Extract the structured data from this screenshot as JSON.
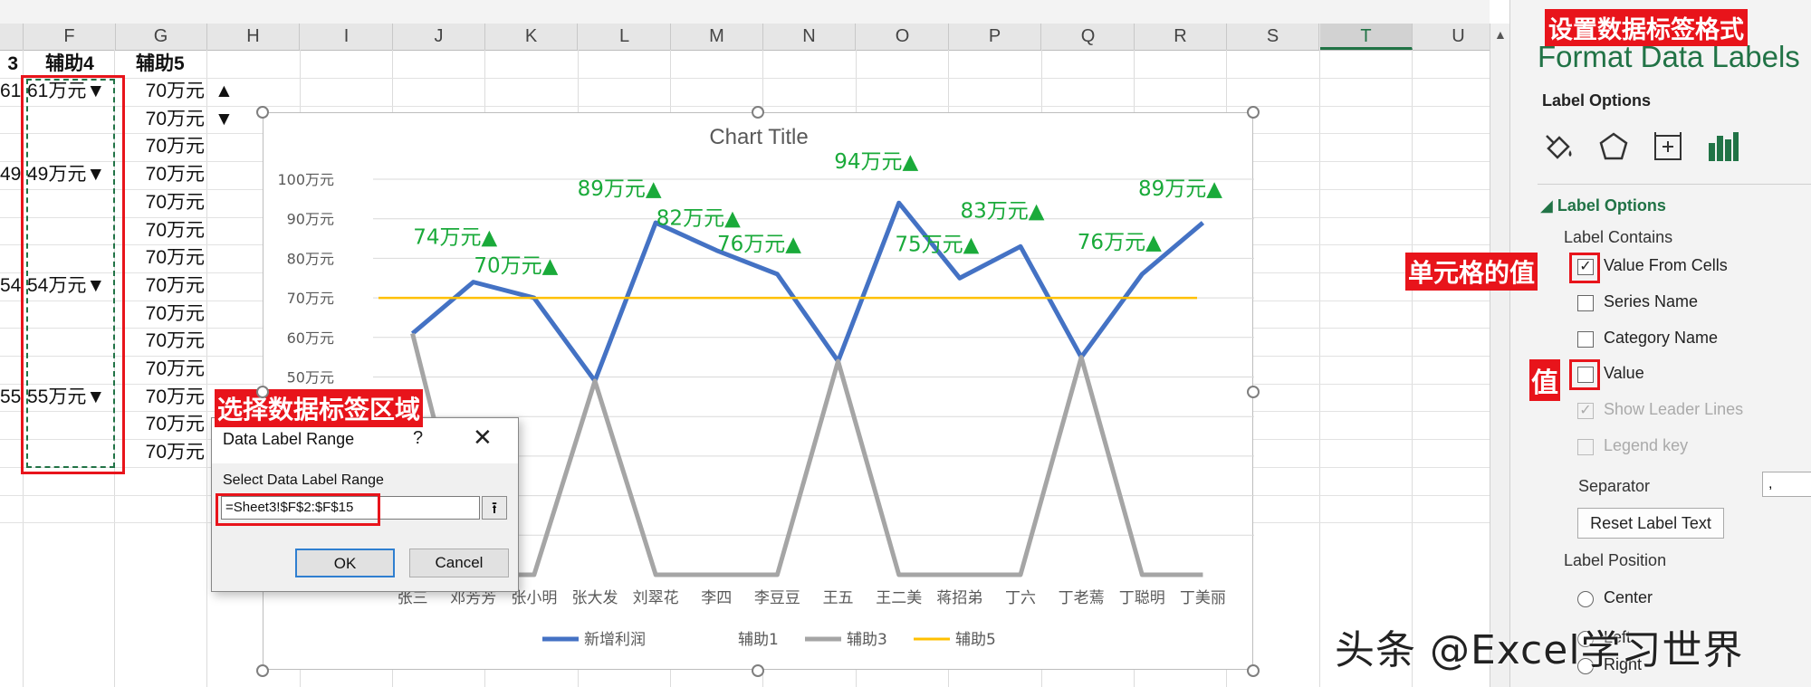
{
  "sheet": {
    "columns": [
      "F",
      "G",
      "H",
      "I",
      "J",
      "K",
      "L",
      "M",
      "N",
      "O",
      "P",
      "Q",
      "R",
      "S",
      "T",
      "U"
    ],
    "selected_column": "T",
    "header_row": {
      "e_partial": "3",
      "f": "辅助4",
      "g": "辅助5"
    },
    "rows": [
      {
        "e": "61",
        "f": "61万元▼",
        "g": "70万元",
        "h": "▲"
      },
      {
        "e": "",
        "f": "",
        "g": "70万元",
        "h": "▼"
      },
      {
        "e": "",
        "f": "",
        "g": "70万元",
        "h": ""
      },
      {
        "e": "49",
        "f": "49万元▼",
        "g": "70万元",
        "h": ""
      },
      {
        "e": "",
        "f": "",
        "g": "70万元",
        "h": ""
      },
      {
        "e": "",
        "f": "",
        "g": "70万元",
        "h": ""
      },
      {
        "e": "",
        "f": "",
        "g": "70万元",
        "h": ""
      },
      {
        "e": "54",
        "f": "54万元▼",
        "g": "70万元",
        "h": ""
      },
      {
        "e": "",
        "f": "",
        "g": "70万元",
        "h": ""
      },
      {
        "e": "",
        "f": "",
        "g": "70万元",
        "h": ""
      },
      {
        "e": "",
        "f": "",
        "g": "70万元",
        "h": ""
      },
      {
        "e": "55",
        "f": "55万元▼",
        "g": "70万元",
        "h": ""
      },
      {
        "e": "",
        "f": "",
        "g": "70万元",
        "h": ""
      },
      {
        "e": "",
        "f": "",
        "g": "70万元",
        "h": ""
      }
    ]
  },
  "chart_data": {
    "type": "line",
    "title": "Chart Title",
    "categories": [
      "张三",
      "邓芳芳",
      "张小明",
      "张大发",
      "刘翠花",
      "李四",
      "李豆豆",
      "王五",
      "王二美",
      "蒋招弟",
      "丁六",
      "丁老蔫",
      "丁聪明",
      "丁美丽"
    ],
    "ylim": [
      0,
      100
    ],
    "y_ticks": [
      "100万元",
      "90万元",
      "80万元",
      "70万元",
      "60万元",
      "50万元"
    ],
    "series": [
      {
        "name": "新增利润",
        "color": "#4472c4",
        "values": [
          61,
          74,
          70,
          49,
          89,
          82,
          76,
          54,
          94,
          75,
          83,
          55,
          76,
          89
        ]
      },
      {
        "name": "辅助1",
        "color": "#ffffff",
        "values": []
      },
      {
        "name": "辅助3",
        "color": "#a5a5a5",
        "values": [
          61,
          0,
          0,
          49,
          0,
          0,
          0,
          54,
          0,
          0,
          0,
          55,
          0,
          0
        ]
      },
      {
        "name": "辅助5",
        "color": "#ffc000",
        "values": [
          70,
          70,
          70,
          70,
          70,
          70,
          70,
          70,
          70,
          70,
          70,
          70,
          70,
          70
        ]
      }
    ],
    "data_labels": [
      {
        "index": 1,
        "text": "74万元▲"
      },
      {
        "index": 2,
        "text": "70万元▲"
      },
      {
        "index": 4,
        "text": "89万元▲"
      },
      {
        "index": 5,
        "text": "82万元▲"
      },
      {
        "index": 6,
        "text": "76万元▲"
      },
      {
        "index": 8,
        "text": "94万元▲"
      },
      {
        "index": 9,
        "text": "75万元▲"
      },
      {
        "index": 10,
        "text": "83万元▲"
      },
      {
        "index": 12,
        "text": "76万元▲"
      },
      {
        "index": 13,
        "text": "89万元▲"
      }
    ],
    "label_color": "#1aaa3a",
    "grid": true,
    "legend": "bottom"
  },
  "dialog": {
    "title": "Data Label Range",
    "help": "?",
    "close": "✕",
    "field_label": "Select Data Label Range",
    "field_value": "=Sheet3!$F$2:$F$15",
    "ok": "OK",
    "cancel": "Cancel"
  },
  "pane": {
    "title": "Format Data Labels",
    "tab_heading": "Label Options",
    "section": "Label Options",
    "label_contains": "Label Contains",
    "options": [
      {
        "label": "Value From Cells",
        "checked": true,
        "disabled": false
      },
      {
        "label": "Series Name",
        "checked": false,
        "disabled": false
      },
      {
        "label": "Category Name",
        "checked": false,
        "disabled": false
      },
      {
        "label": "Value",
        "checked": false,
        "disabled": false
      },
      {
        "label": "Show Leader Lines",
        "checked": true,
        "disabled": true
      },
      {
        "label": "Legend key",
        "checked": false,
        "disabled": true
      }
    ],
    "separator_label": "Separator",
    "separator_value": ",",
    "reset": "Reset Label Text",
    "label_position": "Label Position",
    "positions": [
      "Center",
      "Left",
      "Right"
    ]
  },
  "annotations": {
    "pane_title": "设置数据标签格式",
    "cell_value": "单元格的值",
    "value": "值",
    "select_range": "选择数据标签区域"
  },
  "watermark": "头条 @Excel学习世界",
  "accent_color": "#217346",
  "annotation_color": "#e8141b"
}
